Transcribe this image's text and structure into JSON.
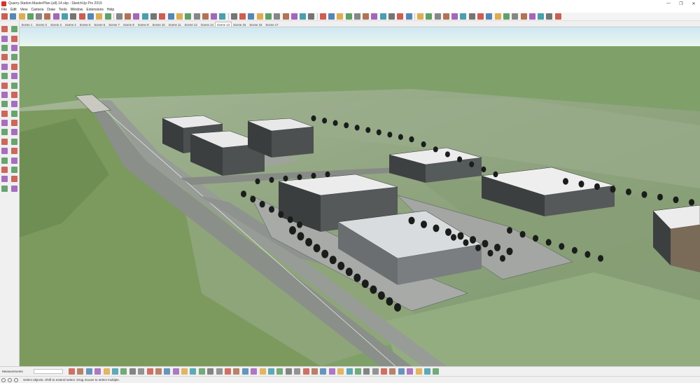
{
  "window": {
    "title": "Quarry-Station-MasterPlan-(all)-14.skp - SketchUp Pro 2019",
    "controls": [
      "—",
      "❐",
      "✕"
    ]
  },
  "menu": [
    "File",
    "Edit",
    "View",
    "Camera",
    "Draw",
    "Tools",
    "Window",
    "Extensions",
    "Help"
  ],
  "scenes": {
    "tabs": [
      "Scene 1",
      "Scene 2",
      "Scene 3",
      "Scene 4",
      "Scene 5",
      "Scene 6",
      "Scene 7",
      "Scene 8",
      "Scene 9",
      "Scene 10",
      "Scene 11",
      "Scene 12",
      "Scene 14",
      "Scene 13",
      "Scene 15",
      "Scene 16",
      "Scene 17"
    ],
    "active": "Scene 13"
  },
  "measurements": {
    "label": "Measurements",
    "value": ""
  },
  "status": {
    "text": "Select objects. Shift to extend select. Drag mouse to select multiple."
  },
  "colors": {
    "sky_top": "#cfe8f3",
    "sky_bottom": "#eaf5ee",
    "ground": "#7fa069",
    "terrain": "#93a884",
    "lawn": "#7c9a5d",
    "road": "#8a8f8a",
    "trees": "#1a1d1a",
    "accent_red": "#d5322e"
  },
  "icons": {
    "toolbar": [
      "select-icon",
      "component-icon",
      "paint-bucket-icon",
      "eraser-icon",
      "rectangle-icon",
      "line-icon",
      "circle-icon",
      "arc-icon",
      "push-pull-icon",
      "offset-icon",
      "move-icon",
      "rotate-icon",
      "scale-icon",
      "tape-measure-icon",
      "text-icon",
      "axes-icon",
      "dimension-icon",
      "protractor-icon",
      "orbit-icon",
      "pan-icon",
      "zoom-icon",
      "zoom-extents-icon",
      "previous-view-icon",
      "position-camera-icon",
      "walk-icon",
      "look-around-icon",
      "section-plane-icon",
      "shaded-icon",
      "wireframe-icon",
      "x-ray-icon",
      "iso-view-icon",
      "top-view-icon",
      "front-view-icon",
      "right-view-icon",
      "back-view-icon",
      "left-view-icon",
      "3d-warehouse-icon",
      "extension-warehouse-icon",
      "layout-icon",
      "geo-location-icon",
      "sandbox-icon",
      "dynamic-component-icon",
      "solid-tools-icon",
      "shadow-icon",
      "fog-icon",
      "style-icon",
      "photo-match-icon",
      "outliner-icon",
      "layers-icon",
      "scenes-icon",
      "instructor-icon",
      "entity-info-icon",
      "materials-icon",
      "components-icon",
      "styles-icon",
      "soften-icon",
      "match-photo-icon",
      "add-location-icon",
      "toggle-terrain-icon",
      "preview-model-icon",
      "upload-icon",
      "download-icon",
      "share-icon",
      "settings-icon"
    ],
    "sidebar": [
      "select-icon",
      "make-component-icon",
      "paint-bucket-icon",
      "eraser-icon",
      "line-icon",
      "freehand-icon",
      "rectangle-icon",
      "rotated-rectangle-icon",
      "circle-icon",
      "polygon-icon",
      "arc-icon",
      "pie-icon",
      "3-point-arc-icon",
      "2-point-arc-icon",
      "push-pull-icon",
      "follow-me-icon",
      "move-icon",
      "offset-icon",
      "rotate-icon",
      "scale-icon",
      "tape-measure-icon",
      "dimension-icon",
      "protractor-icon",
      "text-icon",
      "axes-icon",
      "3d-text-icon",
      "orbit-icon",
      "pan-icon",
      "zoom-icon",
      "zoom-window-icon",
      "zoom-extents-icon",
      "previous-icon",
      "walk-icon",
      "look-around-icon",
      "section-plane-icon",
      "position-camera-icon"
    ],
    "bottom": [
      "move-view-icon",
      "top-view-icon",
      "front-view-icon",
      "iso-view-icon",
      "compass-icon",
      "wireframe-icon",
      "hidden-line-icon",
      "shaded-icon",
      "shaded-texture-icon",
      "monochrome-icon",
      "back-edges-icon",
      "x-ray-icon",
      "section-cut-icon",
      "section-fill-icon",
      "display-section-icon",
      "axes-display-icon",
      "guides-icon",
      "shadows-icon",
      "fog-icon",
      "edge-style-icon",
      "profiles-icon",
      "depth-cue-icon",
      "extensions-icon",
      "sandbox-from-contours-icon",
      "sandbox-scratch-icon",
      "smoove-icon",
      "stamp-icon",
      "drape-icon",
      "add-detail-icon",
      "flip-edge-icon",
      "solid-union-icon",
      "solid-subtract-icon",
      "solid-trim-icon",
      "solid-intersect-icon",
      "outer-shell-icon",
      "split-icon",
      "dynamic-interact-icon",
      "component-options-icon",
      "component-attributes-icon",
      "photo-textures-icon",
      "warehouse-icon",
      "share-model-icon",
      "preview-icon"
    ]
  }
}
